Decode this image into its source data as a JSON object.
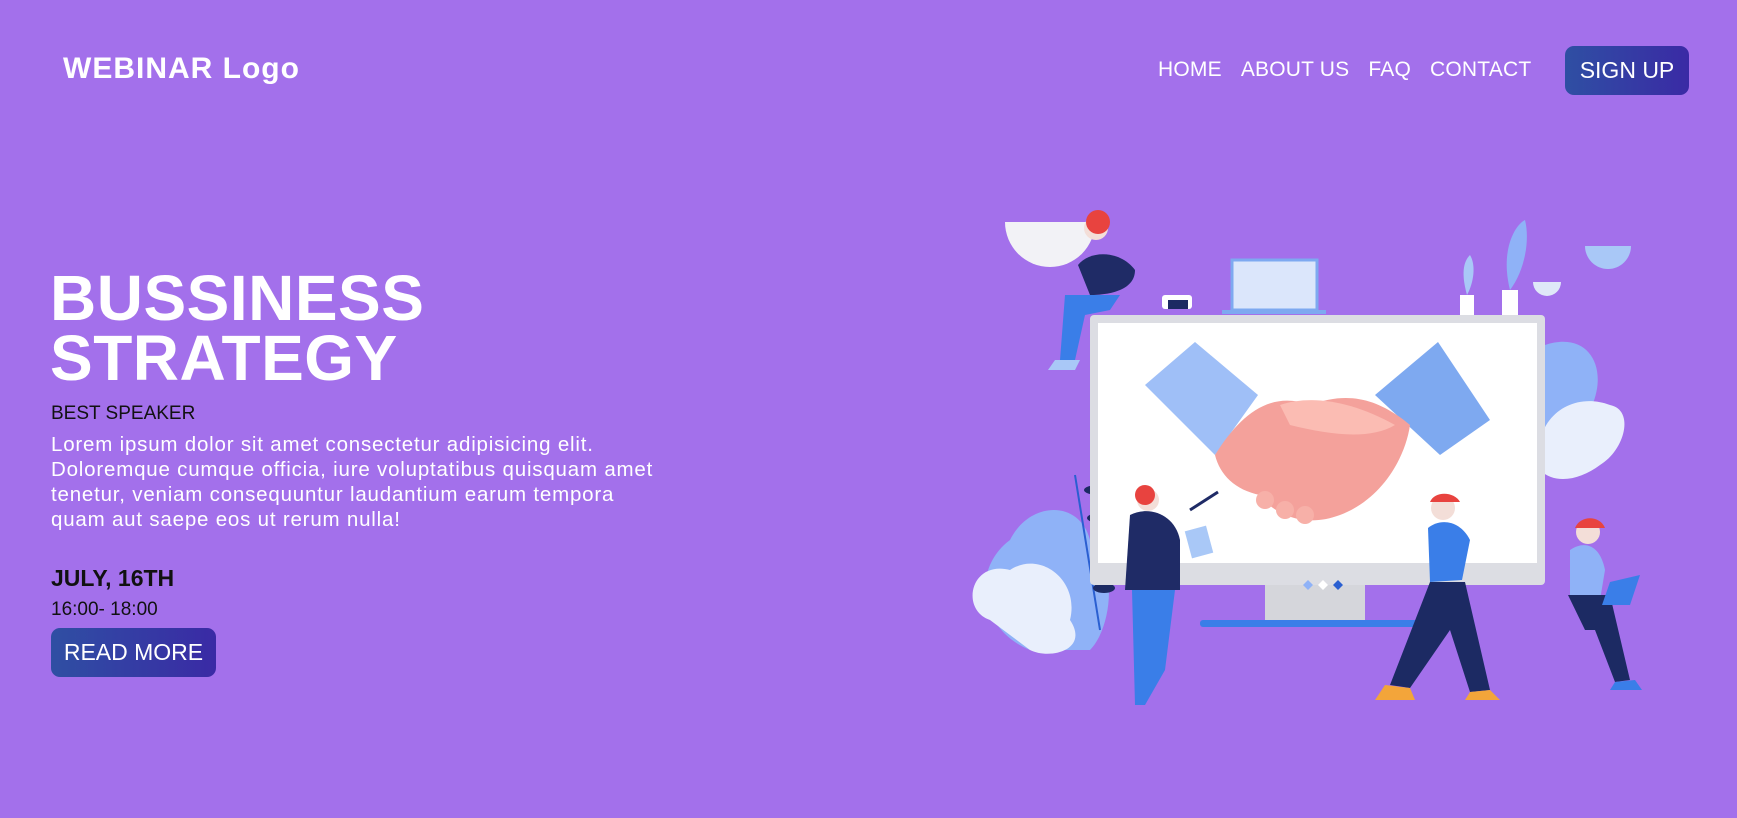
{
  "header": {
    "logo": "WEBINAR Logo",
    "nav": [
      "HOME",
      "ABOUT US",
      "FAQ",
      "CONTACT"
    ],
    "signup_label": "SIGN UP"
  },
  "hero": {
    "title_line1": "BUSSINESS",
    "title_line2": "STRATEGY",
    "speaker": "BEST SPEAKER",
    "description": "Lorem ipsum dolor sit amet consectetur adipisicing elit. Doloremque cumque officia, iure voluptatibus quisquam amet tenetur, veniam consequuntur laudantium earum tempora quam aut saepe eos ut rerum nulla!",
    "date": "JULY, 16TH",
    "time": "16:00- 18:00",
    "read_more_label": "READ MORE"
  },
  "colors": {
    "background": "#a370eb",
    "button_start": "#2f4fa3",
    "button_end": "#3a2aa5"
  },
  "illustration": {
    "icon": "business-handshake-illustration"
  }
}
